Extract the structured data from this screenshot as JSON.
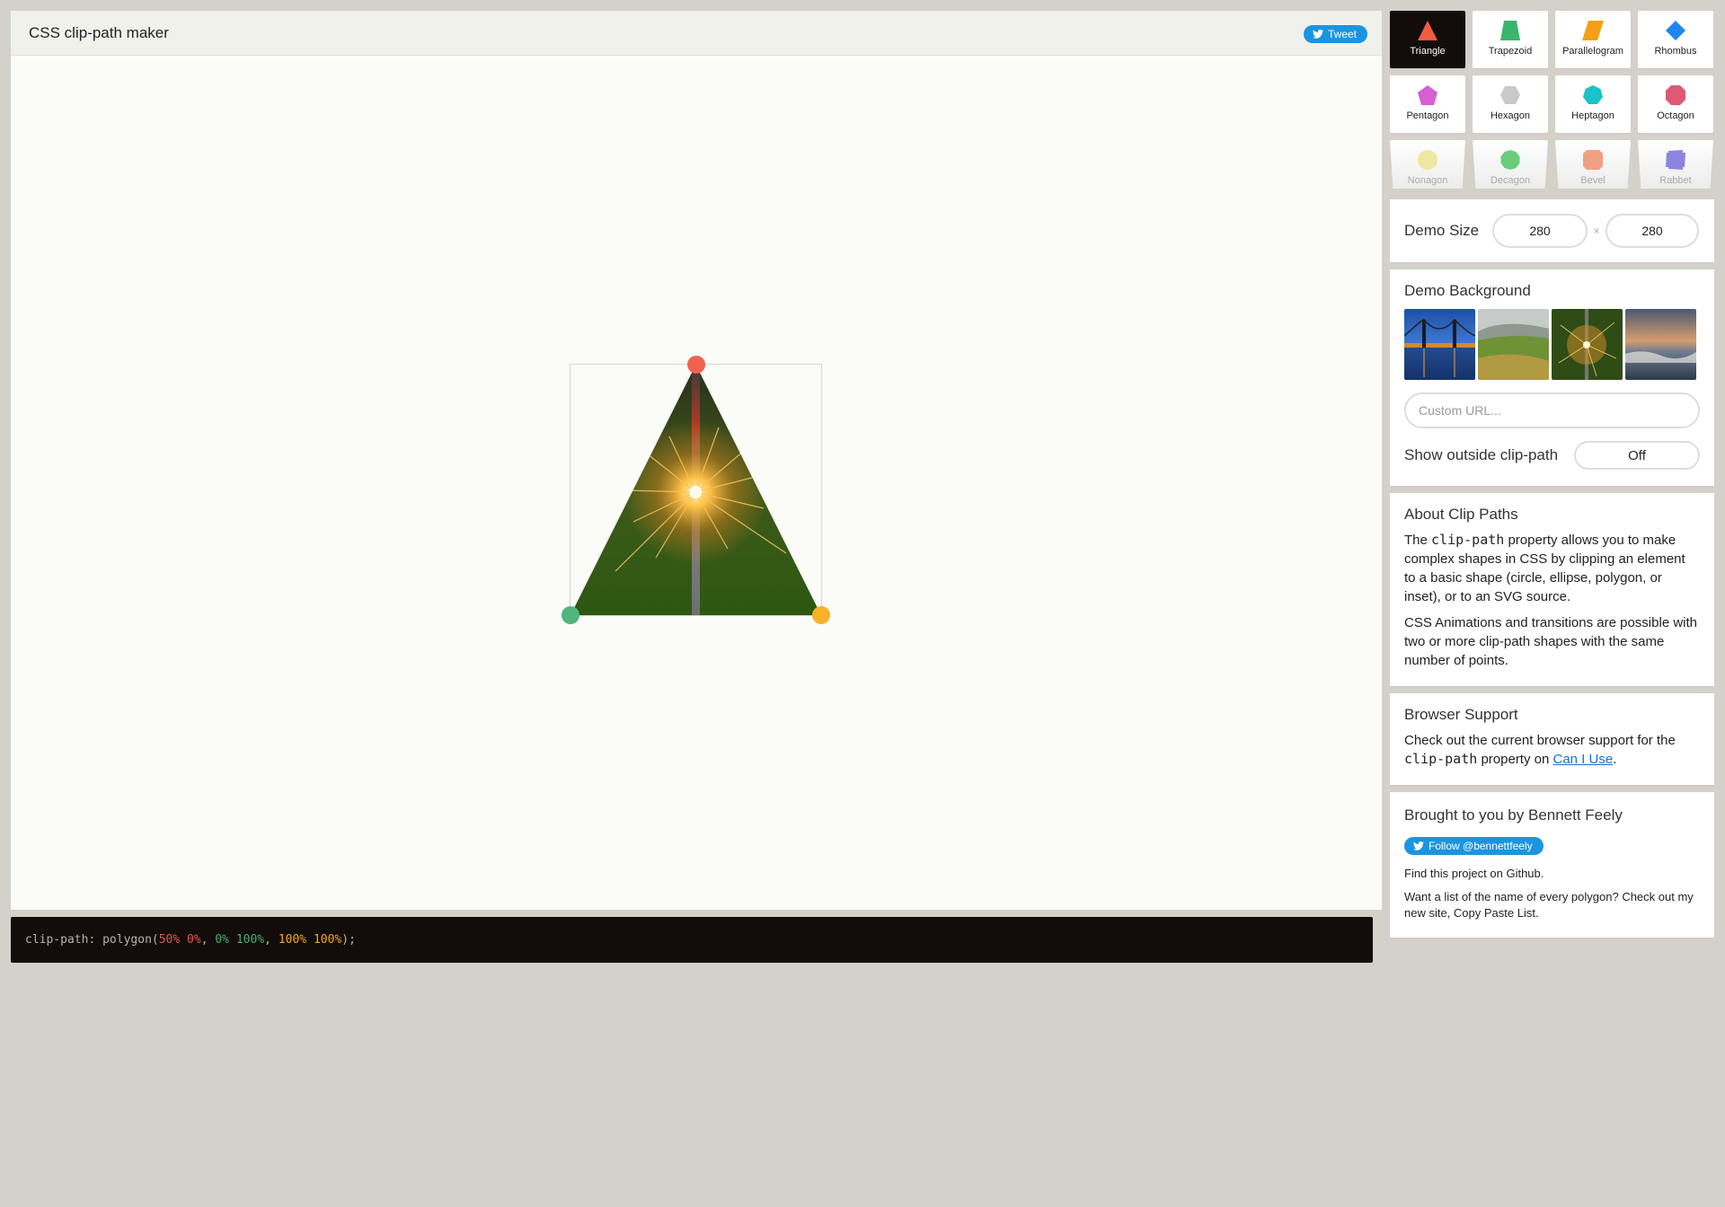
{
  "header": {
    "title": "CSS clip-path maker",
    "tweet_label": "Tweet"
  },
  "code": {
    "property": "clip-path:",
    "func_open": "polygon(",
    "points": [
      {
        "text": "50% 0%",
        "color": "#e8594a"
      },
      {
        "text": "0% 100%",
        "color": "#4cae73"
      },
      {
        "text": "100% 100%",
        "color": "#f6a623"
      }
    ],
    "sep": ", ",
    "func_close": ");",
    "colors": {
      "property": "#b9b2a8",
      "func": "#b9b2a8",
      "punct": "#b9b2a8"
    }
  },
  "shapes": [
    {
      "label": "Triangle",
      "icon": "triangle-icon",
      "color": "#f15b40",
      "active": true
    },
    {
      "label": "Trapezoid",
      "icon": "trapezoid-icon",
      "color": "#3bb56b"
    },
    {
      "label": "Parallelogram",
      "icon": "parallelogram-icon",
      "color": "#f4a012"
    },
    {
      "label": "Rhombus",
      "icon": "rhombus-icon",
      "color": "#1e88f0"
    },
    {
      "label": "Pentagon",
      "icon": "pentagon-icon",
      "color": "#d75ed3"
    },
    {
      "label": "Hexagon",
      "icon": "hexagon-icon",
      "color": "#c9c9c9"
    },
    {
      "label": "Heptagon",
      "icon": "heptagon-icon",
      "color": "#19c3c9"
    },
    {
      "label": "Octagon",
      "icon": "octagon-icon",
      "color": "#dc5a76"
    },
    {
      "label": "Nonagon",
      "icon": "nonagon-icon",
      "color": "#e9e27a"
    },
    {
      "label": "Decagon",
      "icon": "decagon-icon",
      "color": "#2bbd47"
    },
    {
      "label": "Bevel",
      "icon": "bevel-icon",
      "color": "#f07b52"
    },
    {
      "label": "Rabbet",
      "icon": "rabbet-icon",
      "color": "#5f55d8"
    }
  ],
  "demo_size": {
    "label": "Demo Size",
    "width": "280",
    "height": "280",
    "separator": "×"
  },
  "demo_background": {
    "title": "Demo Background",
    "thumbnails": [
      "bridge-night-thumbnail",
      "green-valley-thumbnail",
      "sparkler-thumbnail",
      "ocean-sunset-thumbnail"
    ],
    "url_placeholder": "Custom URL...",
    "outside_label": "Show outside clip-path",
    "outside_value": "Off"
  },
  "about": {
    "title": "About Clip Paths",
    "p1_a": "The ",
    "p1_code": "clip-path",
    "p1_b": " property allows you to make complex shapes in CSS by clipping an element to a basic shape (circle, ellipse, polygon, or inset), or to an SVG source.",
    "p2": "CSS Animations and transitions are possible with two or more clip-path shapes with the same number of points."
  },
  "support": {
    "title": "Browser Support",
    "text_a": "Check out the current browser support for the ",
    "code": "clip-path",
    "text_b": " property on ",
    "link": "Can I Use",
    "text_c": "."
  },
  "credits": {
    "title": "Brought to you by Bennett Feely",
    "follow_label": "Follow @bennettfeely",
    "github_a": "Find this project on ",
    "github_link": "Github",
    "github_b": ".",
    "list_a": "Want a list of the name of every polygon? Check out my new site, ",
    "list_link": "Copy Paste List",
    "list_b": "."
  },
  "handles": [
    {
      "name": "handle-top",
      "color": "#f0644f"
    },
    {
      "name": "handle-bottom-left",
      "color": "#52b57c"
    },
    {
      "name": "handle-bottom-right",
      "color": "#f8b22a"
    }
  ]
}
